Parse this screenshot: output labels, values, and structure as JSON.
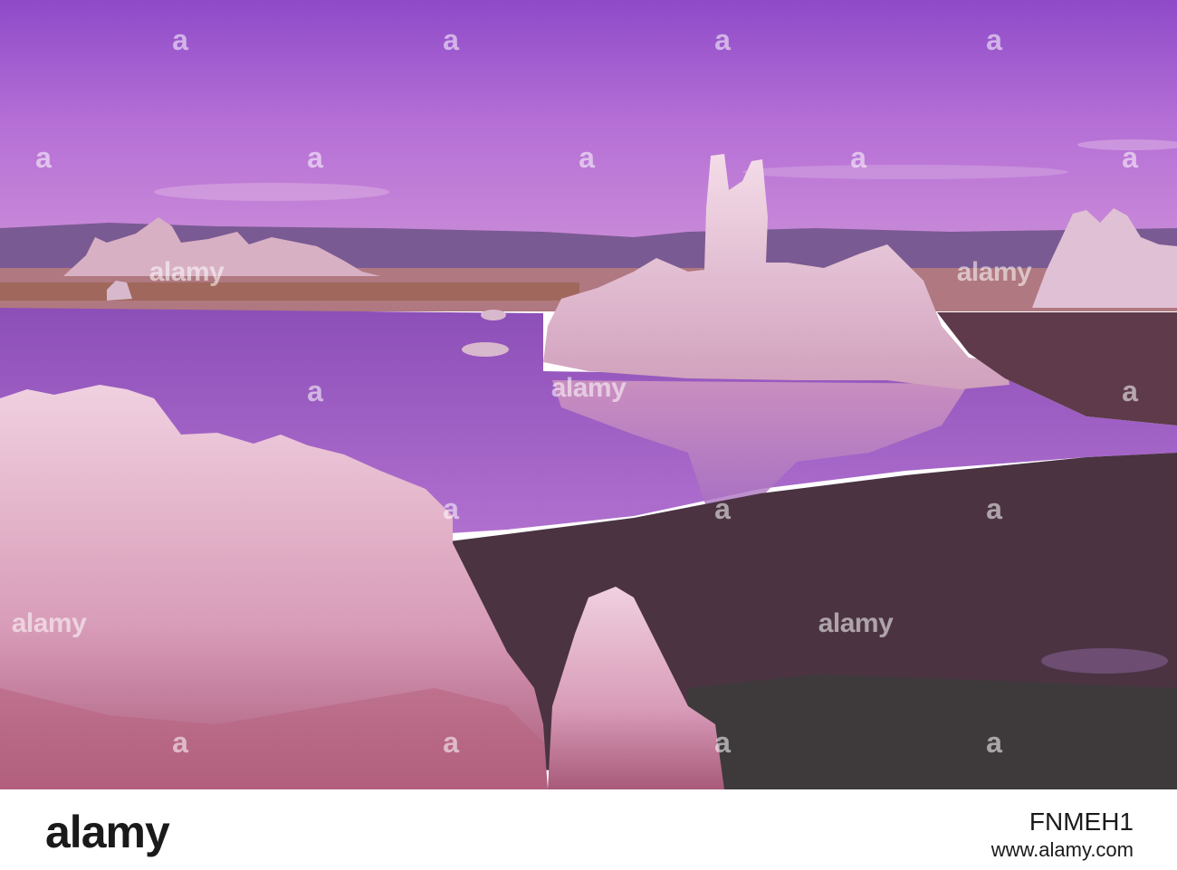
{
  "watermark": {
    "letter": "a",
    "word": "alamy"
  },
  "footer": {
    "logo": "alamy",
    "image_id": "FNMEH1",
    "url": "www.alamy.com"
  },
  "colors": {
    "sky_top": "#9a4fd0",
    "sky_bottom": "#c080dc",
    "lake": "#a060c8",
    "tufa": "#e8c0d4",
    "shore": "#4a3040",
    "footer_bg": "#ffffff",
    "footer_text": "#1a1a1a"
  }
}
